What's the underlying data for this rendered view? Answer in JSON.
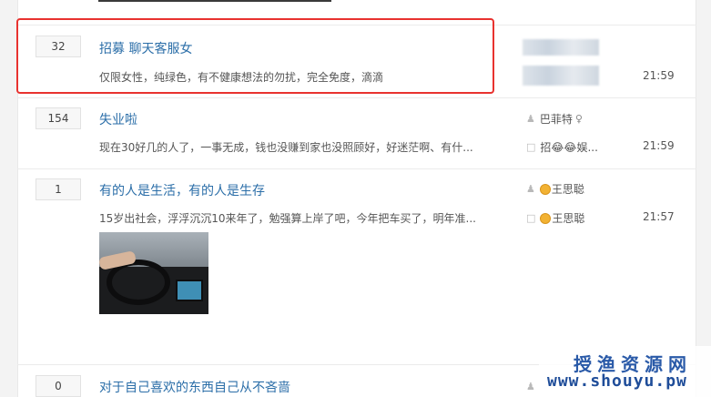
{
  "topics": [
    {
      "count": "32",
      "title": "招募 聊天客服女",
      "excerpt": "仅限女性，纯绿色，有不健康想法的勿扰，完全免度，滴滴",
      "author": "",
      "last_reply": "",
      "time": "21:59"
    },
    {
      "count": "154",
      "title": "失业啦",
      "excerpt": "现在30好几的人了，一事无成，钱也没赚到家也没照顾好，好迷茫啊、有什...",
      "author": "巴菲特",
      "last_reply": "招😂😂娱...",
      "time": "21:59"
    },
    {
      "count": "1",
      "title": "有的人是生活，有的人是生存",
      "excerpt": "15岁出社会，浮浮沉沉10来年了，勉强算上岸了吧，今年把车买了，明年准...",
      "author": "王思聪",
      "last_reply": "王思聪",
      "time": "21:57"
    },
    {
      "count": "0",
      "title": "对于自己喜欢的东西自己从不吝啬",
      "excerpt": "",
      "author": "",
      "last_reply": "",
      "time": ""
    }
  ],
  "watermark": {
    "line1": "授渔资源网",
    "line2": "www.shouyu.pw"
  },
  "icons": {
    "user": "user-icon",
    "reply": "comment-icon",
    "gender": "female-icon"
  }
}
